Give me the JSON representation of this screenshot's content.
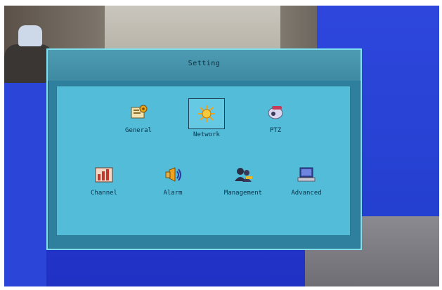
{
  "dialog": {
    "title": "Setting"
  },
  "menu": {
    "items": [
      {
        "label": "General",
        "icon": "general-icon"
      },
      {
        "label": "Network",
        "icon": "network-icon",
        "selected": true
      },
      {
        "label": "PTZ",
        "icon": "ptz-camera-icon"
      },
      {
        "label": "Channel",
        "icon": "channel-icon"
      },
      {
        "label": "Alarm",
        "icon": "alarm-icon"
      },
      {
        "label": "Management",
        "icon": "management-icon"
      },
      {
        "label": "Advanced",
        "icon": "advanced-icon"
      }
    ]
  },
  "colors": {
    "background_blue": "#2a40d8",
    "dialog_frame": "#2f7f9e",
    "dialog_body": "#53bcd9",
    "dialog_border": "#7fe0f0",
    "label_text": "#07334a"
  }
}
